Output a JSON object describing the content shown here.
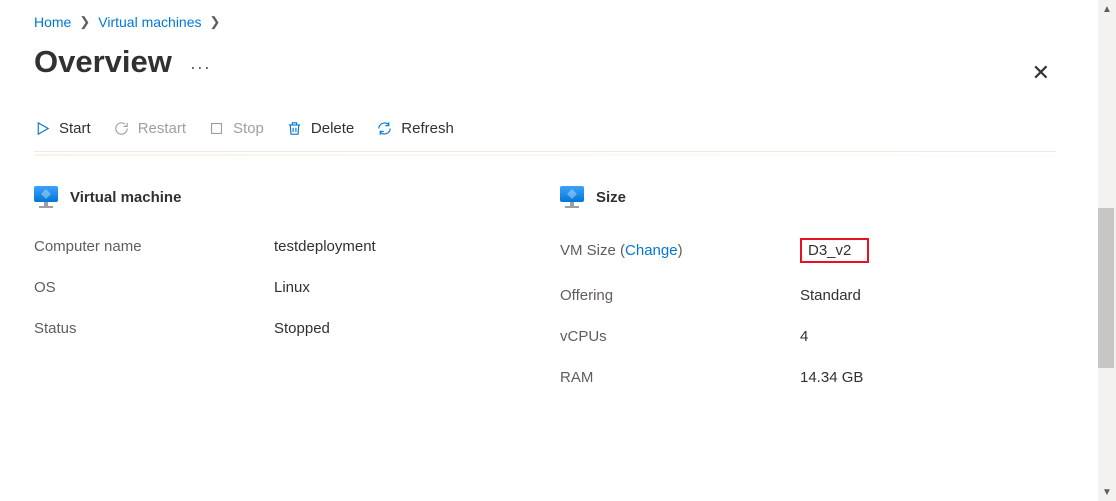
{
  "breadcrumb": {
    "home": "Home",
    "vms": "Virtual machines"
  },
  "page_title": "Overview",
  "toolbar": {
    "start": "Start",
    "restart": "Restart",
    "stop": "Stop",
    "delete": "Delete",
    "refresh": "Refresh"
  },
  "sections": {
    "vm": {
      "header": "Virtual machine",
      "rows": {
        "computer_name": {
          "label": "Computer name",
          "value": "testdeployment"
        },
        "os": {
          "label": "OS",
          "value": "Linux"
        },
        "status": {
          "label": "Status",
          "value": "Stopped"
        }
      }
    },
    "size": {
      "header": "Size",
      "change_link": "Change",
      "rows": {
        "vm_size": {
          "label_prefix": "VM Size (",
          "label_suffix": ")",
          "value": "D3_v2"
        },
        "offering": {
          "label": "Offering",
          "value": "Standard"
        },
        "vcpus": {
          "label": "vCPUs",
          "value": "4"
        },
        "ram": {
          "label": "RAM",
          "value": "14.34 GB"
        }
      }
    }
  }
}
